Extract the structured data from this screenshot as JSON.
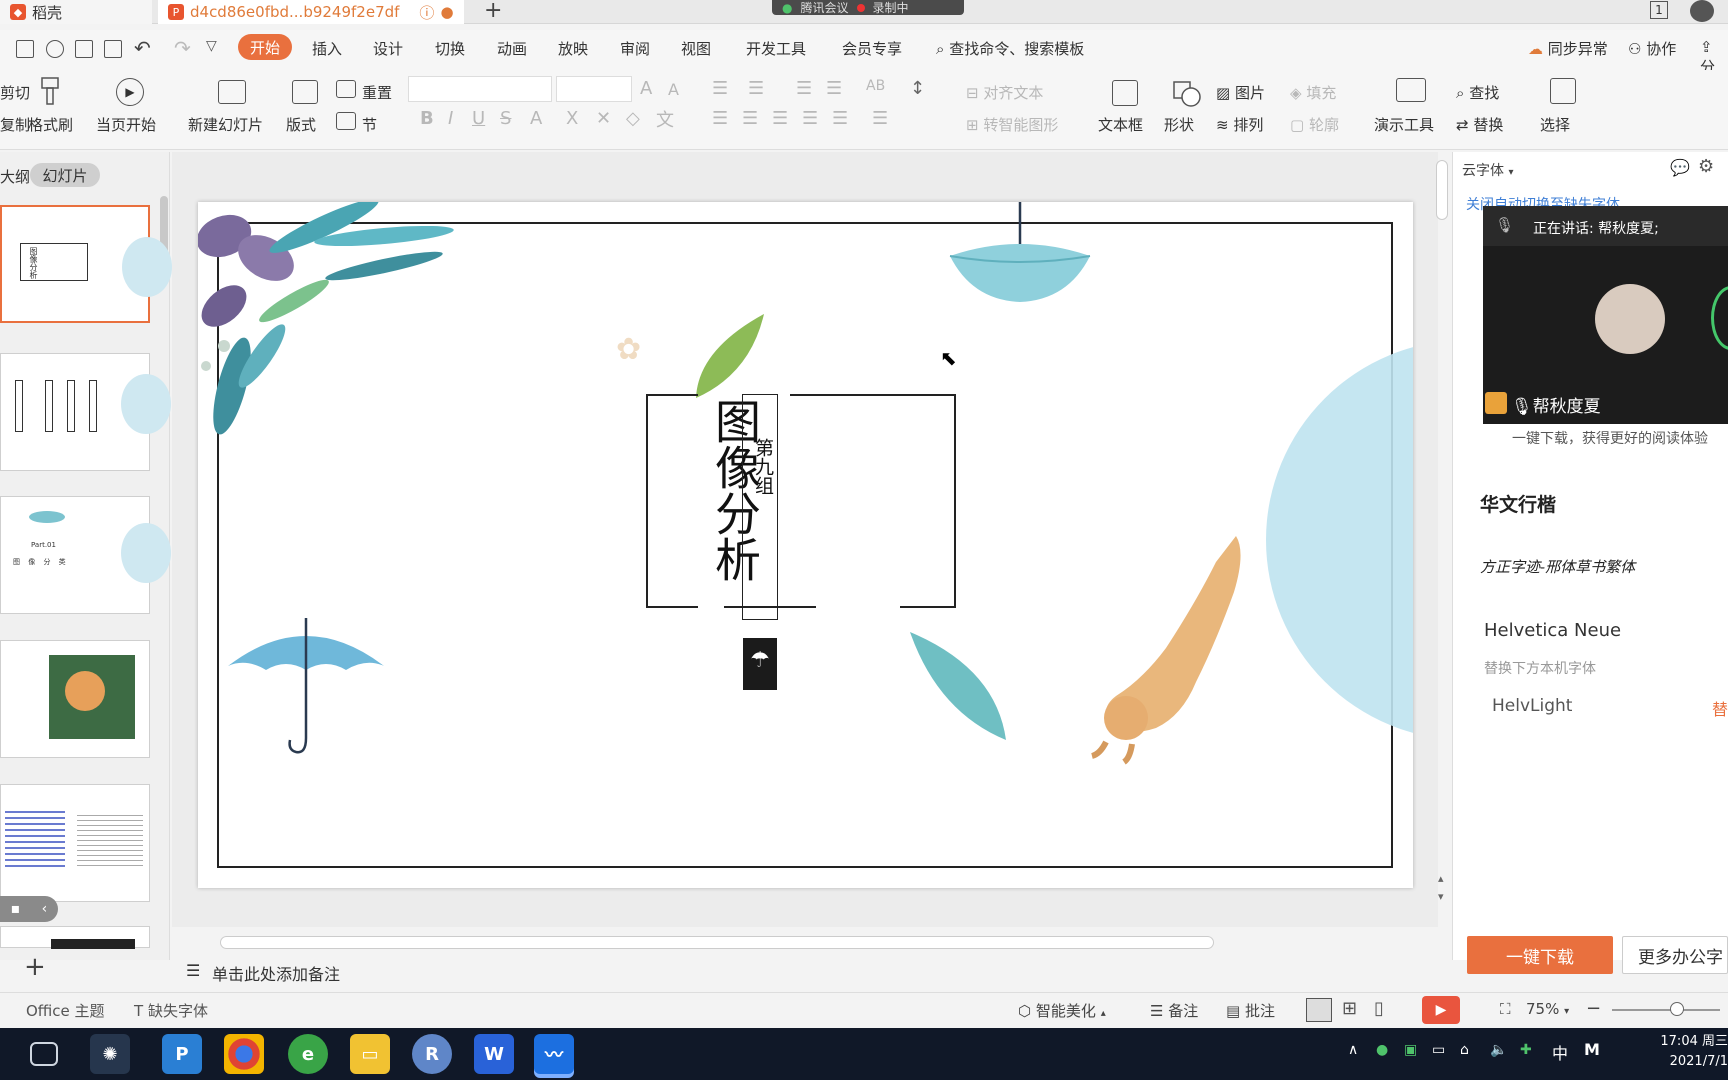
{
  "tabs": {
    "home": "稻壳",
    "doc": "d4cd86e0fbd...b9249f2e7df",
    "new_tab": "+"
  },
  "meeting": {
    "app": "腾讯会议",
    "recording": "录制中"
  },
  "window": {
    "page_count": "1"
  },
  "menu": {
    "items": [
      "开始",
      "插入",
      "设计",
      "切换",
      "动画",
      "放映",
      "审阅",
      "视图",
      "开发工具",
      "会员专享"
    ],
    "search": "查找命令、搜索模板",
    "sync": "同步异常",
    "collab": "协作",
    "share": "分"
  },
  "ribbon": {
    "cut": "剪切",
    "copy": "复制",
    "format_painter": "格式刷",
    "from_current": "当页开始",
    "new_slide": "新建幻灯片",
    "layout": "版式",
    "reset": "重置",
    "section": "节",
    "align_text": "对齐文本",
    "smart_art": "转智能图形",
    "textbox": "文本框",
    "shape": "形状",
    "picture": "图片",
    "fill": "填充",
    "arrange": "排列",
    "outline": "轮廓",
    "present_tools": "演示工具",
    "find": "查找",
    "replace": "替换",
    "select": "选择"
  },
  "left_panel": {
    "outline_tab": "大纲",
    "slides_tab": "幻灯片"
  },
  "thumbnails": {
    "t1_title": "图像分析",
    "t3_part": "Part.01",
    "t3_sub": "图 像 分 类"
  },
  "slide": {
    "title": "图像分析",
    "group": "第九组"
  },
  "right_panel": {
    "cloud_font": "云字体",
    "auto_switch": "关闭自动切换至缺失字体",
    "speaking": "正在讲话: 帮秋度夏;",
    "participant": "帮秋度夏",
    "download_hint": "一键下载，获得更好的阅读体验",
    "font1": "华文行楷",
    "font2": "方正字迹-邢体草书繁体",
    "font3": "Helvetica Neue",
    "replace_hint": "替换下方本机字体",
    "font4": "HelvLight",
    "font4_action": "替",
    "download_btn": "一键下载",
    "more_btn": "更多办公字"
  },
  "notes": {
    "placeholder": "单击此处添加备注"
  },
  "status": {
    "theme": "Office 主题",
    "missing_font": "缺失字体",
    "beautify": "智能美化",
    "notes": "备注",
    "comments": "批注",
    "zoom": "75%"
  },
  "taskbar": {
    "time": "17:04 周三",
    "date": "2021/7/1",
    "ime": "中"
  },
  "colors": {
    "accent": "#e9703e",
    "teal": "#5fb8c6",
    "sky": "#bfe3ef"
  }
}
